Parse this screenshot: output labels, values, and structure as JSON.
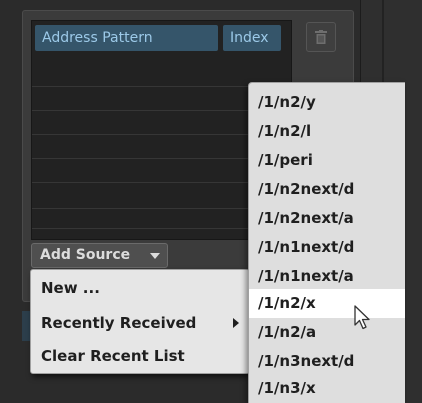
{
  "columns": {
    "address": "Address Pattern",
    "index": "Index"
  },
  "add_source_label": "Add Source",
  "menu": {
    "items": [
      "New ...",
      "Recently Received",
      "Clear Recent List"
    ],
    "selected": "Recently Received"
  },
  "submenu": {
    "items": [
      "/1/n2/y",
      "/1/n2/l",
      "/1/peri",
      "/1/n2next/d",
      "/1/n2next/a",
      "/1/n1next/d",
      "/1/n1next/a",
      "/1/n2/x",
      "/1/n2/a",
      "/1/n3next/d",
      "/1/n3/x"
    ],
    "hovered": "/1/n2/x"
  },
  "icons": {
    "delete": "trash-icon",
    "add_source_dropdown": "triangle-down-icon",
    "submenu_indicator": "triangle-right-icon",
    "pointer": "mouse-cursor-icon"
  },
  "colors": {
    "header_bg": "#35556a",
    "header_text": "#9cc9e8",
    "menu_bg": "#e6e6e6",
    "hover_bg": "#ffffff"
  }
}
